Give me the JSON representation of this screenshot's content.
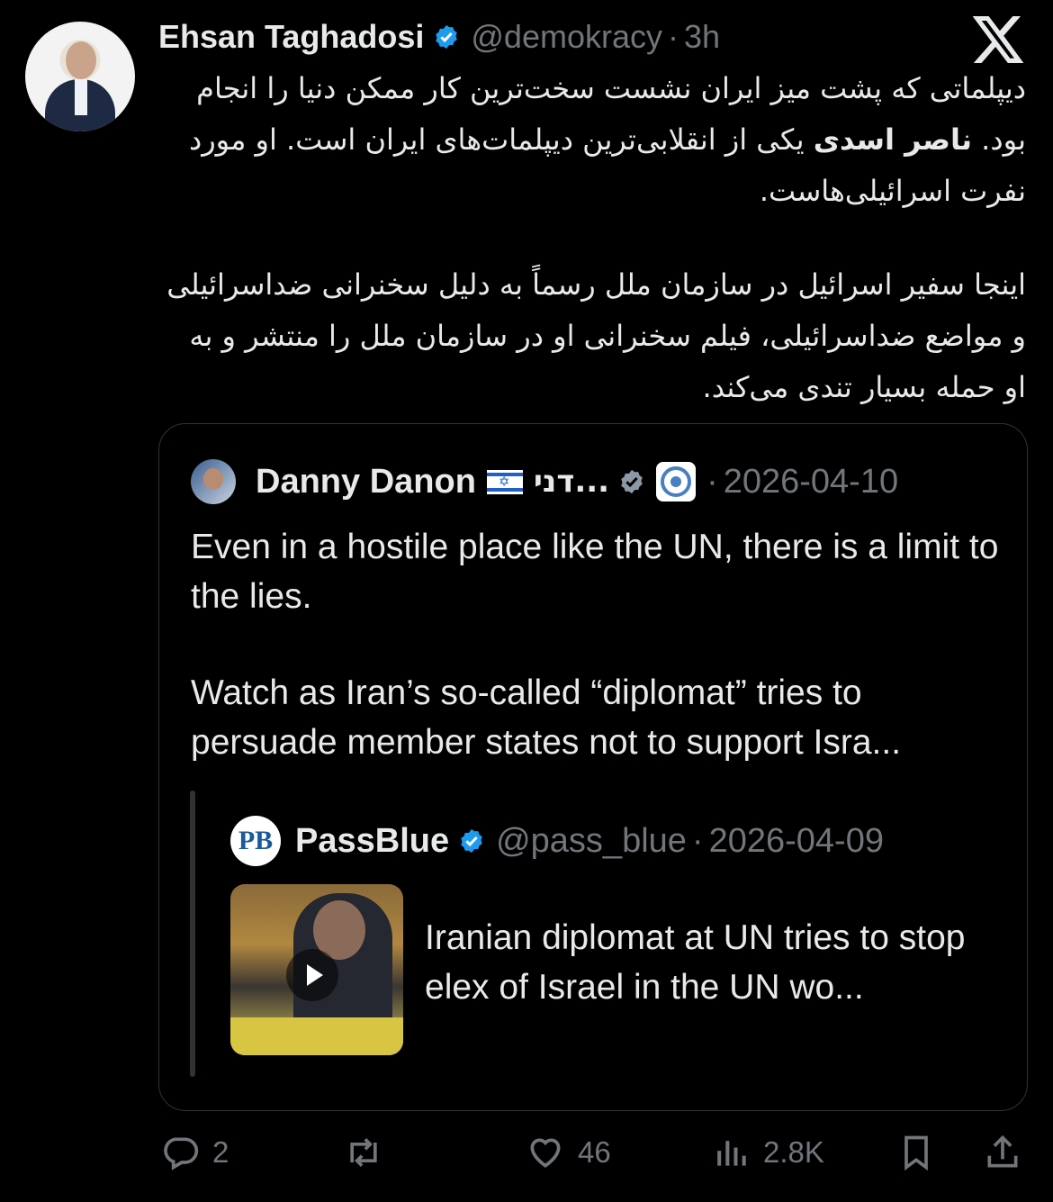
{
  "tweet": {
    "author_name": "Ehsan Taghadosi",
    "handle": "@demokracy",
    "separator": "·",
    "time": "3h",
    "paragraph1": {
      "before": "دیپلماتی که پشت میز ایران نشست سخت‌ترین کار ممکن دنیا را انجام بود. ",
      "bold": "ناصر اسدی",
      "after": " یکی از انقلابی‌ترین دیپلمات‌های ایران است. او مورد نفرت اسرائیلی‌هاست."
    },
    "paragraph2": "اینجا سفیر اسرائیل در سازمان ملل رسماً به دلیل سخنرانی ضداسرائیلی و مواضع ضداسرائیلی، فیلم سخنرانی او در سازمان ملل را منتشر و به او حمله بسیار تندی می‌کند."
  },
  "quoted": {
    "author_name": "Danny Danon",
    "flag_star": "✡",
    "name_extra": "דני...",
    "separator": "·",
    "date": "2026-04-10",
    "paragraph1": "Even in a hostile place like the UN, there is a limit to the lies.",
    "paragraph2": "Watch as Iran’s so-called “diplomat” tries to persuade member states not to support Isra..."
  },
  "nested": {
    "logo_text": "PB",
    "author_name": "PassBlue",
    "handle": "@pass_blue",
    "separator": "·",
    "date": "2026-04-09",
    "card_title": "Iranian diplomat at UN tries to stop elex of Israel in the UN wo..."
  },
  "actions": {
    "replies": "2",
    "retweets": "",
    "likes": "46",
    "views": "2.8K"
  },
  "icons": [
    "verified-badge-icon",
    "x-logo-icon",
    "play-icon",
    "reply-icon",
    "retweet-icon",
    "like-icon",
    "views-icon",
    "bookmark-icon",
    "share-icon"
  ],
  "colors": {
    "background": "#000000",
    "text": "#e7e9ea",
    "muted": "#71767b",
    "verified": "#1d9bf0",
    "border": "#2f3336"
  }
}
